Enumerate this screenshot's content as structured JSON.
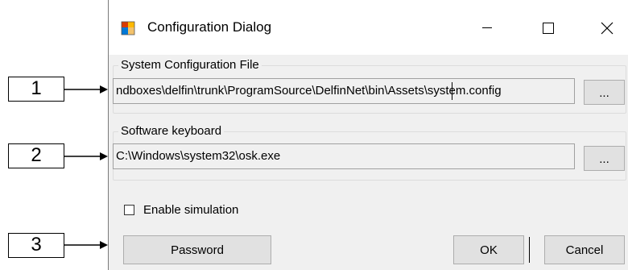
{
  "callouts": [
    "1",
    "2",
    "3"
  ],
  "window": {
    "title": "Configuration Dialog",
    "icon": "app-window-icon",
    "caption_buttons": [
      "minimize-icon",
      "maximize-icon",
      "close-icon"
    ]
  },
  "system_config": {
    "legend": "System Configuration File",
    "path": "ndboxes\\delfin\\trunk\\ProgramSource\\DelfinNet\\bin\\Assets\\system.config",
    "browse_label": "..."
  },
  "keyboard": {
    "legend": "Software keyboard",
    "path": "C:\\Windows\\system32\\osk.exe",
    "browse_label": "..."
  },
  "simulation": {
    "label": "Enable simulation",
    "checked": false
  },
  "buttons": {
    "password": "Password",
    "ok": "OK",
    "cancel": "Cancel"
  }
}
